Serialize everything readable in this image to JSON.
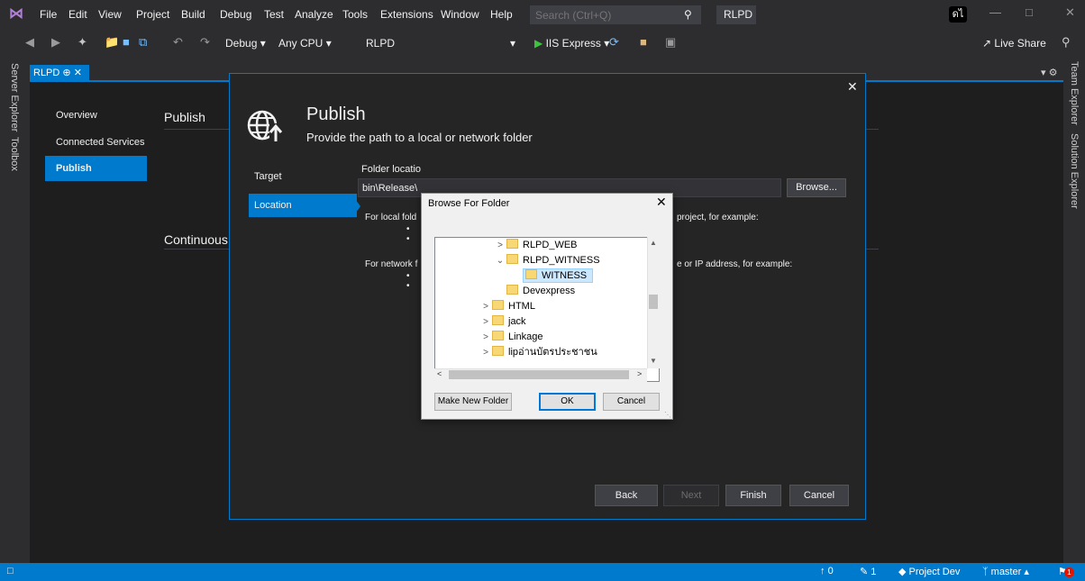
{
  "menu": {
    "items": [
      "File",
      "Edit",
      "View",
      "Project",
      "Build",
      "Debug",
      "Test",
      "Analyze",
      "Tools",
      "Extensions",
      "Window",
      "Help"
    ],
    "search_placeholder": "Search (Ctrl+Q)",
    "solution_name": "RLPD",
    "account_initials": "ดไ"
  },
  "toolbar": {
    "config": "Debug",
    "platform": "Any CPU",
    "project": "RLPD",
    "run_target": "IIS Express",
    "live_share": "Live Share"
  },
  "side_tabs": {
    "left": [
      "Server Explorer",
      "Toolbox"
    ],
    "right": [
      "Team Explorer",
      "Solution Explorer"
    ]
  },
  "document": {
    "tab_label": "RLPD"
  },
  "nav": {
    "items": [
      "Overview",
      "Connected Services",
      "Publish"
    ]
  },
  "background": {
    "publish_heading": "Publish",
    "continuous_heading": "Continuous"
  },
  "publish_dialog": {
    "title": "Publish",
    "subtitle": "Provide the path to a local or network folder",
    "steps": [
      "Target",
      "Location"
    ],
    "folder_label": "Folder locatio",
    "folder_value": "bin\\Release\\",
    "browse_label": "Browse...",
    "local_help_left": "For local fold",
    "local_help_right": "project, for example:",
    "network_help_left": "For network f",
    "network_help_right": "e or IP address, for example:",
    "buttons": {
      "back": "Back",
      "next": "Next",
      "finish": "Finish",
      "cancel": "Cancel"
    }
  },
  "browse_dialog": {
    "title": "Browse For Folder",
    "tree": [
      {
        "label": "RLPD_WEB",
        "arrow": ">"
      },
      {
        "label": "RLPD_WITNESS",
        "arrow": "v"
      },
      {
        "label": "WITNESS",
        "arrow": ""
      },
      {
        "label": "Devexpress",
        "arrow": ""
      },
      {
        "label": "HTML",
        "arrow": ">"
      },
      {
        "label": "jack",
        "arrow": ">"
      },
      {
        "label": "Linkage",
        "arrow": ">"
      },
      {
        "label": "lipอ่านบัตรประชาชน",
        "arrow": ">"
      }
    ],
    "make_new_folder": "Make New Folder",
    "ok": "OK",
    "cancel": "Cancel"
  },
  "statusbar": {
    "up_count": "0",
    "edit_count": "1",
    "project": "Project Dev",
    "branch": "master",
    "notifications": "1"
  },
  "colors": {
    "accent": "#007acc",
    "chrome": "#2d2d30",
    "editor_bg": "#1e1e1e"
  }
}
